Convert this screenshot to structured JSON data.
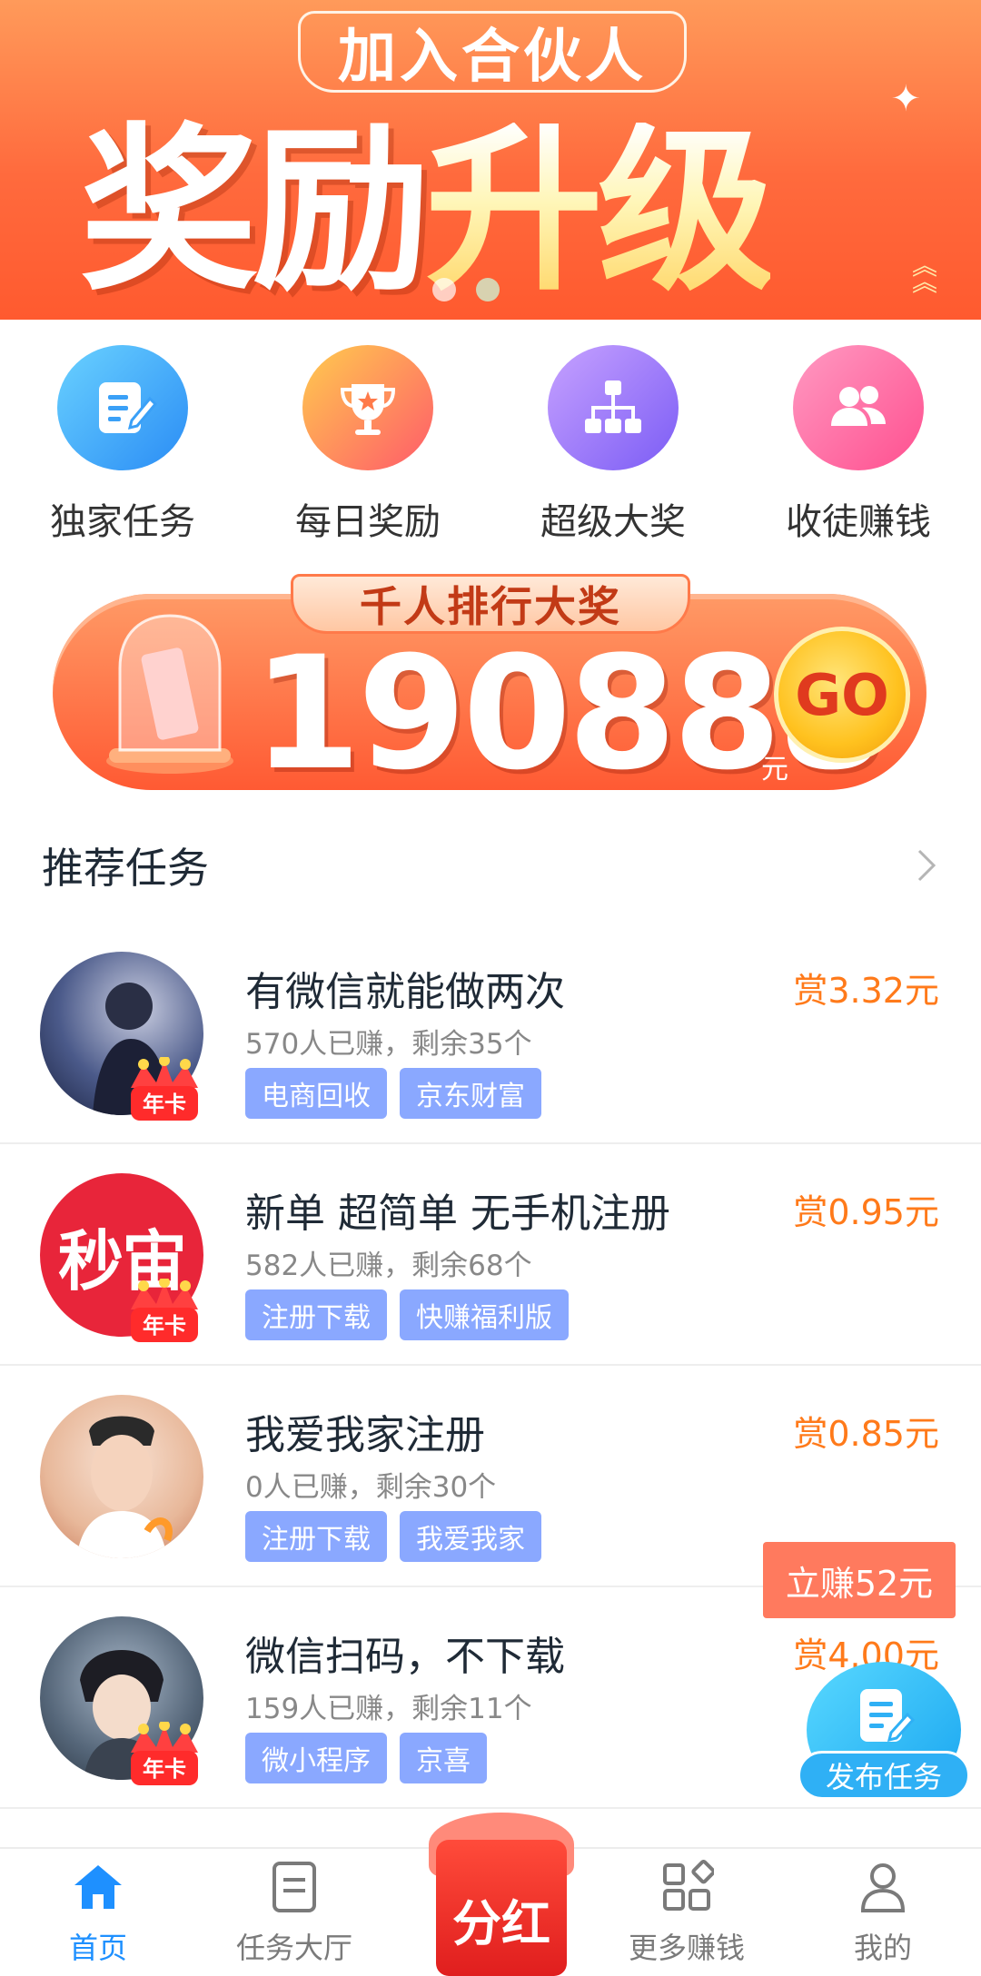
{
  "banner": {
    "subtitle": "加入合伙人",
    "title_part1": "奖励",
    "title_part2": "升级",
    "dots": 2,
    "active_dot": 1
  },
  "entries": [
    {
      "label": "独家任务",
      "icon": "edit-list-icon"
    },
    {
      "label": "每日奖励",
      "icon": "trophy-icon"
    },
    {
      "label": "超级大奖",
      "icon": "hierarchy-icon"
    },
    {
      "label": "收徒赚钱",
      "icon": "users-icon"
    }
  ],
  "ranking": {
    "tag": "千人排行大奖",
    "amount": "190888",
    "unit": "元",
    "go": "GO"
  },
  "section": {
    "title": "推荐任务"
  },
  "tasks": [
    {
      "title": "有微信就能做两次",
      "reward": "赏3.32元",
      "meta": "570人已赚，剩余35个",
      "tags": [
        "电商回收",
        "京东财富"
      ],
      "badge": "年卡"
    },
    {
      "title": "新单 超简单 无手机注册",
      "reward": "赏0.95元",
      "meta": "582人已赚，剩余68个",
      "tags": [
        "注册下载",
        "快赚福利版"
      ],
      "badge": "年卡",
      "avatar_text": "秒宙"
    },
    {
      "title": "我爱我家注册",
      "reward": "赏0.85元",
      "meta": "0人已赚，剩余30个",
      "tags": [
        "注册下载",
        "我爱我家"
      ]
    },
    {
      "title": "微信扫码，不下载",
      "reward": "赏4.00元",
      "meta": "159人已赚，剩余11个",
      "tags": [
        "微小程序",
        "京喜"
      ],
      "badge": "年卡"
    }
  ],
  "float": {
    "earn": "立赚52元",
    "publish": "发布任务"
  },
  "nav": [
    {
      "label": "首页",
      "icon": "home-icon",
      "active": true
    },
    {
      "label": "任务大厅",
      "icon": "document-icon",
      "active": false
    },
    {
      "label": "分红",
      "icon": "red-packet-icon",
      "active": false
    },
    {
      "label": "更多赚钱",
      "icon": "grid-icon",
      "active": false
    },
    {
      "label": "我的",
      "icon": "person-icon",
      "active": false
    }
  ],
  "colors": {
    "accent_blue": "#1e90ff",
    "reward_orange": "#ff7a1a",
    "tag_blue": "#8aa8ff",
    "banner_orange": "#ff6a3d"
  }
}
